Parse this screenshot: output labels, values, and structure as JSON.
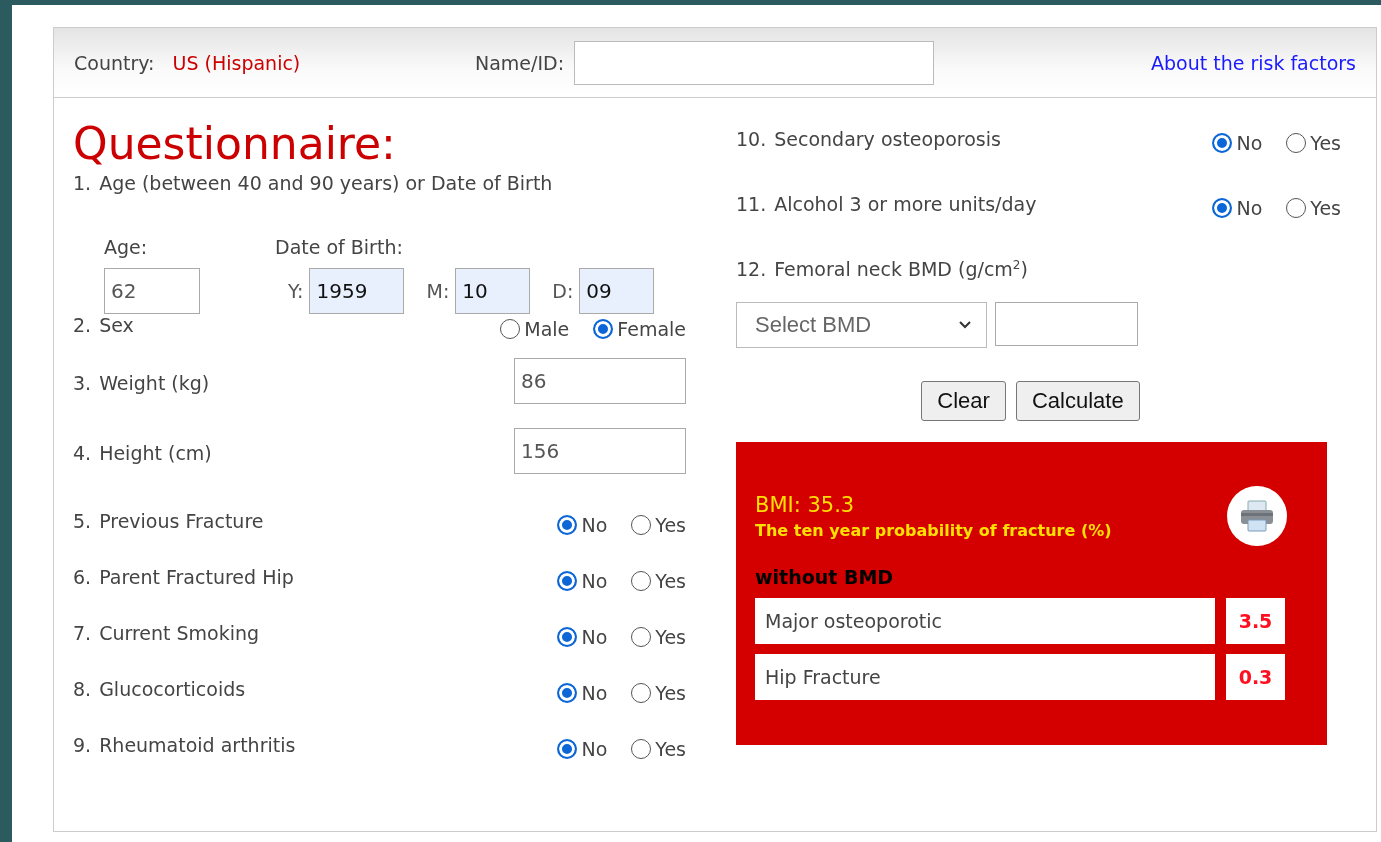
{
  "header": {
    "country_label": "Country:",
    "country": "US (Hispanic)",
    "name_label": "Name/ID:",
    "link": "About the risk factors"
  },
  "title": "Questionnaire:",
  "left_questions": [
    {
      "kind": "age",
      "number": "1.",
      "label": "Age (between 40 and 90 years) or Date of Birth",
      "age_label": "Age:",
      "age_value": "62",
      "dob_label": "Date of Birth:",
      "dob": [
        {
          "label": "Y:",
          "value": "1959"
        },
        {
          "label": "M:",
          "value": "10"
        },
        {
          "label": "D:",
          "value": "09"
        }
      ]
    },
    {
      "kind": "radio",
      "number": "2.",
      "label": "Sex",
      "options": [
        {
          "label": "Male",
          "selected": false
        },
        {
          "label": "Female",
          "selected": true
        }
      ]
    },
    {
      "kind": "input",
      "number": "3.",
      "label": "Weight (kg)",
      "value": "86"
    },
    {
      "kind": "input",
      "number": "4.",
      "label": "Height (cm)",
      "value": "156"
    },
    {
      "kind": "radio",
      "number": "5.",
      "label": "Previous Fracture",
      "options": [
        {
          "label": "No",
          "selected": true
        },
        {
          "label": "Yes",
          "selected": false
        }
      ]
    },
    {
      "kind": "radio",
      "number": "6.",
      "label": "Parent Fractured Hip",
      "options": [
        {
          "label": "No",
          "selected": true
        },
        {
          "label": "Yes",
          "selected": false
        }
      ]
    },
    {
      "kind": "radio",
      "number": "7.",
      "label": "Current Smoking",
      "options": [
        {
          "label": "No",
          "selected": true
        },
        {
          "label": "Yes",
          "selected": false
        }
      ]
    },
    {
      "kind": "radio",
      "number": "8.",
      "label": "Glucocorticoids",
      "options": [
        {
          "label": "No",
          "selected": true
        },
        {
          "label": "Yes",
          "selected": false
        }
      ]
    },
    {
      "kind": "radio",
      "number": "9.",
      "label": "Rheumatoid arthritis",
      "options": [
        {
          "label": "No",
          "selected": true
        },
        {
          "label": "Yes",
          "selected": false
        }
      ]
    }
  ],
  "right_questions": [
    {
      "kind": "radio",
      "number": "10.",
      "label": "Secondary osteoporosis",
      "options": [
        {
          "label": "No",
          "selected": true
        },
        {
          "label": "Yes",
          "selected": false
        }
      ]
    },
    {
      "kind": "radio",
      "number": "11.",
      "label": "Alcohol 3 or more units/day",
      "options": [
        {
          "label": "No",
          "selected": true
        },
        {
          "label": "Yes",
          "selected": false
        }
      ]
    },
    {
      "kind": "bmd",
      "number": "12.",
      "label": "Femoral neck BMD (g/cm$^{2}$)",
      "select": "Select BMD"
    }
  ],
  "buttons": [
    "Clear",
    "Calculate"
  ],
  "result": {
    "bmi": "BMI: 35.3",
    "subtitle": "The ten year probability of fracture (%)",
    "section": "without BMD",
    "rows": [
      {
        "label": "Major osteoporotic",
        "value": "3.5"
      },
      {
        "label": "Hip Fracture",
        "value": "0.3"
      }
    ]
  }
}
